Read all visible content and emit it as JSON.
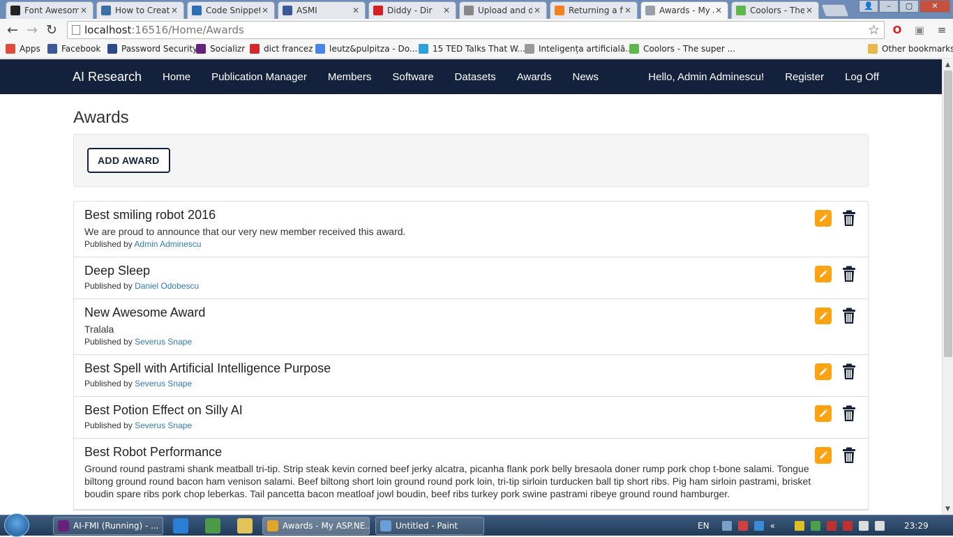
{
  "browser": {
    "tabs": [
      {
        "title": "Font Awesome",
        "favicon_color": "#222222",
        "glyph": "⚑"
      },
      {
        "title": "How to Create",
        "favicon_color": "#3b6fa5",
        "glyph": "t"
      },
      {
        "title": "Code Snippet",
        "favicon_color": "#2e6fb3",
        "glyph": "<b>"
      },
      {
        "title": "ASMI",
        "favicon_color": "#3b5998",
        "glyph": "f"
      },
      {
        "title": "Diddy - Dir",
        "favicon_color": "#d32020",
        "glyph": "▶"
      },
      {
        "title": "Upload and do",
        "favicon_color": "#888888",
        "glyph": ""
      },
      {
        "title": "Returning a file",
        "favicon_color": "#f48024",
        "glyph": "≡"
      },
      {
        "title": "Awards - My A",
        "favicon_color": "#9aa0a8",
        "glyph": ""
      },
      {
        "title": "Coolors - The",
        "favicon_color": "#5fb64a",
        "glyph": "●"
      }
    ],
    "address": {
      "host": "localhost",
      "path": ":16516/Home/Awards"
    },
    "bookmarks": [
      {
        "label": "Apps",
        "icon": "apps-grid-icon",
        "color": "#e04b3a"
      },
      {
        "label": "Facebook",
        "icon": "facebook-icon",
        "color": "#3b5998"
      },
      {
        "label": "Password Security",
        "icon": "s-icon",
        "color": "#2a4a8a"
      },
      {
        "label": "Socializr",
        "icon": "visual-studio-icon",
        "color": "#68217a"
      },
      {
        "label": "dict francez",
        "icon": "dict-icon",
        "color": "#d22a2a"
      },
      {
        "label": "leutz&pulpitza - Do...",
        "icon": "docs-icon",
        "color": "#4a86e8"
      },
      {
        "label": "15 TED Talks That W...",
        "icon": "m-icon",
        "color": "#2aa1d8"
      },
      {
        "label": "Inteligența artificială...",
        "icon": "page-icon",
        "color": "#999999"
      },
      {
        "label": "Coolors - The super ...",
        "icon": "coolors-icon",
        "color": "#5fb64a"
      }
    ],
    "other_bookmarks": "Other bookmarks"
  },
  "site": {
    "brand": "AI Research",
    "nav": [
      "Home",
      "Publication Manager",
      "Members",
      "Software",
      "Datasets",
      "Awards",
      "News"
    ],
    "user": {
      "greeting": "Hello, Admin Adminescu!",
      "register": "Register",
      "logoff": "Log Off"
    },
    "colors": {
      "navbar": "#14213d",
      "accent": "#fca311",
      "link": "#337ab7"
    }
  },
  "page": {
    "title": "Awards",
    "add_button": "ADD AWARD",
    "published_by_label": "Published by",
    "awards": [
      {
        "title": "Best smiling robot 2016",
        "description": "We are proud to announce that our very new member received this award.",
        "author": "Admin Adminescu"
      },
      {
        "title": "Deep Sleep",
        "description": "",
        "author": "Daniel Odobescu"
      },
      {
        "title": "New Awesome Award",
        "description": "Tralala",
        "author": "Severus Snape"
      },
      {
        "title": "Best Spell with Artificial Intelligence Purpose",
        "description": "",
        "author": "Severus Snape"
      },
      {
        "title": "Best Potion Effect on Silly AI",
        "description": "",
        "author": "Severus Snape"
      },
      {
        "title": "Best Robot Performance",
        "description": "Ground round pastrami shank meatball tri-tip. Strip steak kevin corned beef jerky alcatra, picanha flank pork belly bresaola doner rump pork chop t-bone salami. Tongue biltong ground round bacon ham venison salami. Beef biltong short loin ground round pork loin, tri-tip sirloin turducken ball tip short ribs. Pig ham sirloin pastrami, brisket boudin spare ribs pork chop leberkas. Tail pancetta bacon meatloaf jowl boudin, beef ribs turkey pork swine pastrami ribeye ground round hamburger.",
        "author": ""
      }
    ]
  },
  "taskbar": {
    "tasks": [
      {
        "label": "AI-FMI (Running) - ...",
        "icon_color": "#68217a"
      },
      {
        "label": "Awards - My ASP.NE...",
        "icon_color": "#e0a52a"
      },
      {
        "label": "Untitled - Paint",
        "icon_color": "#6aa0d8"
      }
    ],
    "lang": "EN",
    "time": "23:29"
  }
}
